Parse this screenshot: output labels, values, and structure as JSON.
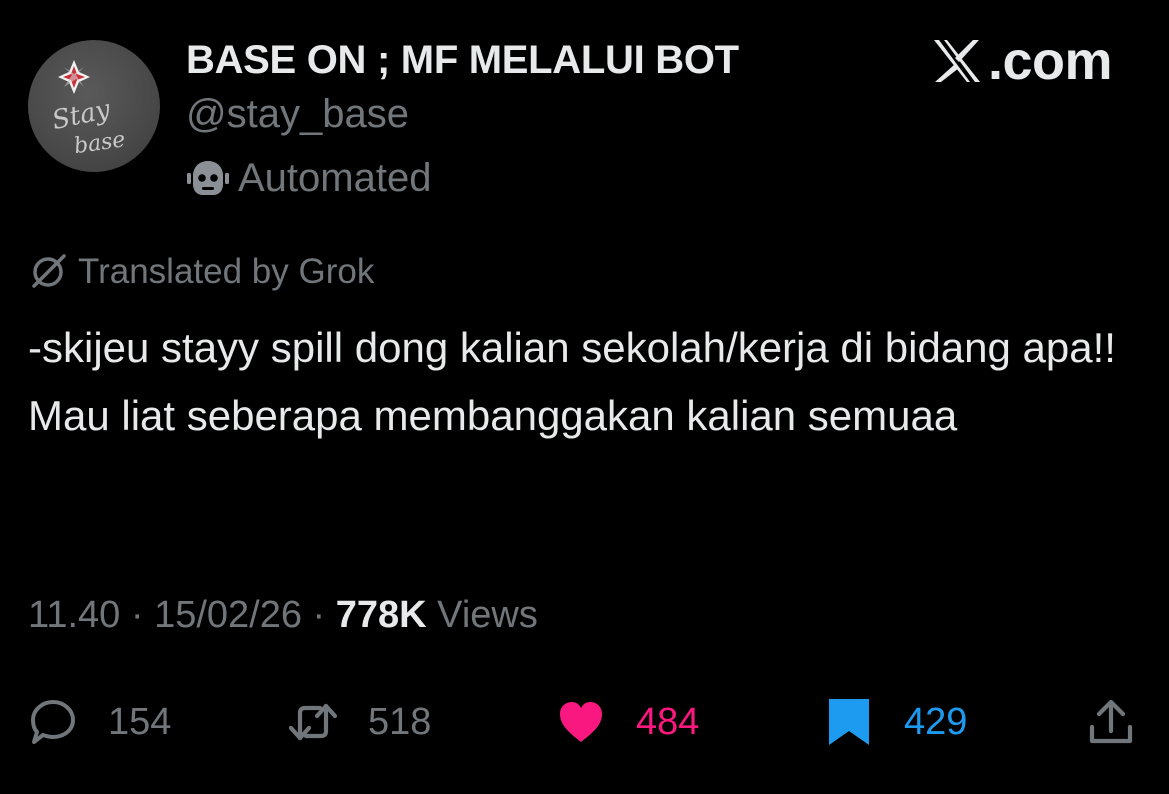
{
  "author": {
    "name": "BASE ON ; MF MELALUI BOT",
    "handle": "@stay_base",
    "badge_label": "Automated",
    "badge_icon": "robot-icon",
    "avatar_text": [
      "Stay",
      "base"
    ]
  },
  "brand": {
    "text": ".com",
    "icon": "x-logo-icon"
  },
  "translation": {
    "label": "Translated by Grok",
    "icon": "grok-icon"
  },
  "tweet": {
    "text": "-skijeu stayy spill dong kalian sekolah/kerja di bidang apa!! Mau liat seberapa membanggakan kalian semuaa"
  },
  "meta": {
    "time": "11.40",
    "separator": "·",
    "date": "15/02/26",
    "views_count": "778K",
    "views_label": "Views"
  },
  "actions": {
    "replies": {
      "count": "154",
      "icon": "reply-icon",
      "color": "#71767b"
    },
    "reposts": {
      "count": "518",
      "icon": "repost-icon",
      "color": "#71767b"
    },
    "likes": {
      "count": "484",
      "icon": "heart-icon",
      "color": "#f91880"
    },
    "bookmarks": {
      "count": "429",
      "icon": "bookmark-icon",
      "color": "#1d9bf0"
    },
    "share": {
      "icon": "share-icon",
      "color": "#71767b"
    }
  }
}
